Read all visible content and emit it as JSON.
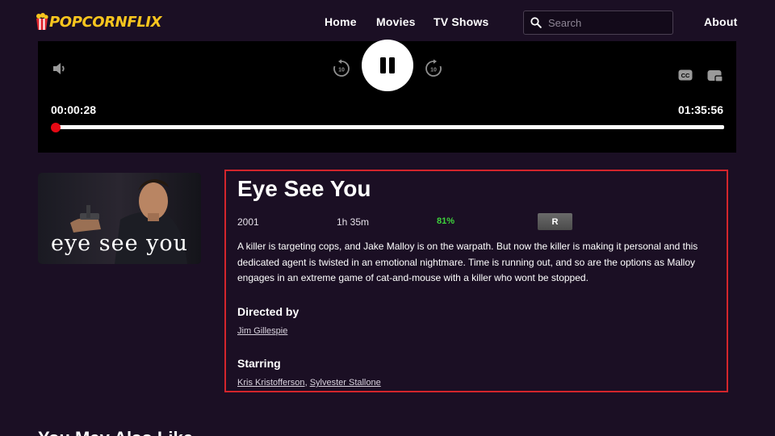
{
  "header": {
    "logo_text": "POPCORNFLIX",
    "nav": [
      "Home",
      "Movies",
      "TV Shows"
    ],
    "search_placeholder": "Search",
    "about": "About"
  },
  "player": {
    "current_time": "00:00:28",
    "duration": "01:35:56",
    "progress_fraction": 0.005,
    "state": "playing",
    "icons": [
      "volume-icon",
      "replay-10-icon",
      "pause-icon",
      "forward-10-icon",
      "closed-captions-icon",
      "picture-in-picture-icon"
    ],
    "rewind_label": "10",
    "forward_label": "10",
    "cc_label": "CC"
  },
  "poster": {
    "caption": "eye see you"
  },
  "movie": {
    "title": "Eye See You",
    "year": "2001",
    "runtime": "1h 35m",
    "score": "81%",
    "rating": "R",
    "description": "A killer is targeting cops, and Jake Malloy is on the warpath. But now the killer is making it personal and this dedicated agent is twisted in an emotional nightmare. Time is running out, and so are the options as Malloy engages in an extreme game of cat-and-mouse with a killer who wont be stopped.",
    "directed_label": "Directed by",
    "director": "Jim Gillespie",
    "starring_label": "Starring",
    "cast": [
      "Kris Kristofferson",
      "Sylvester Stallone"
    ],
    "cast_separator": ", "
  },
  "more": {
    "title": "You May Also Like"
  },
  "colors": {
    "background": "#1b0f24",
    "logo": "#f7c51e",
    "score": "#3ed33c",
    "highlight_border": "#d3252c",
    "progress": "#e50914"
  }
}
